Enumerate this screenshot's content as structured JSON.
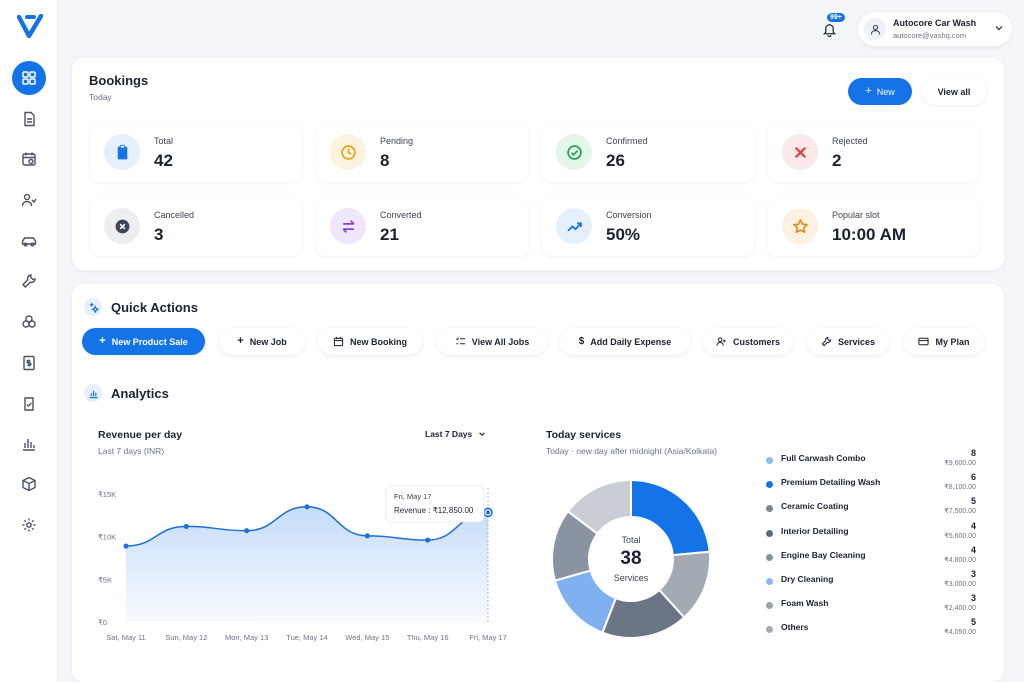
{
  "sidebar": {
    "logo": "V",
    "items": [
      {
        "icon": "grid-icon"
      },
      {
        "icon": "document-icon"
      },
      {
        "icon": "calendar-icon"
      },
      {
        "icon": "users-icon"
      },
      {
        "icon": "car-icon"
      },
      {
        "icon": "wrench-icon"
      },
      {
        "icon": "layers-icon"
      },
      {
        "icon": "invoice-icon"
      },
      {
        "icon": "clipboard-check-icon"
      },
      {
        "icon": "bar-chart-icon"
      },
      {
        "icon": "box-icon"
      },
      {
        "icon": "settings-icon"
      }
    ]
  },
  "header": {
    "notifications_badge": "99+",
    "user": {
      "name": "Autocore Car Wash",
      "email": "autocore@vashq.com"
    }
  },
  "bookings": {
    "title": "Bookings",
    "subtitle": "Today",
    "new_label": "New",
    "view_all_label": "View all",
    "stats": [
      {
        "label": "Total",
        "value": "42"
      },
      {
        "label": "Pending",
        "value": "8"
      },
      {
        "label": "Confirmed",
        "value": "26"
      },
      {
        "label": "Rejected",
        "value": "2"
      },
      {
        "label": "Cancelled",
        "value": "3"
      },
      {
        "label": "Converted",
        "value": "21"
      },
      {
        "label": "Conversion",
        "value": "50%"
      },
      {
        "label": "Popular slot",
        "value": "10:00 AM"
      }
    ]
  },
  "quick_actions": {
    "title": "Quick Actions",
    "buttons": [
      {
        "label": "New Product Sale"
      },
      {
        "label": "New Job"
      },
      {
        "label": "New Booking"
      },
      {
        "label": "View All Jobs"
      },
      {
        "label": "Add Daily Expense"
      },
      {
        "label": "Customers"
      },
      {
        "label": "Services"
      },
      {
        "label": "My Plan"
      }
    ]
  },
  "analytics": {
    "title": "Analytics",
    "revenue": {
      "title": "Revenue per day",
      "subtitle": "Last 7 days (INR)",
      "range": "Last 7 Days",
      "tooltip": {
        "date": "Fri, May 17",
        "label": "Revenue : ₹12,850.00"
      }
    },
    "services": {
      "title": "Today services",
      "subtitle": "Today · new day after midnight (Asia/Kolkata)",
      "total_label": "Total",
      "total_value": "38",
      "total_unit": "Services",
      "items": [
        {
          "name": "Full Carwash Combo",
          "count": "8",
          "amount": "₹9,600.00",
          "color": "#8fb8f2"
        },
        {
          "name": "Premium Detailing Wash",
          "count": "6",
          "amount": "₹8,100.00",
          "color": "#1473e6"
        },
        {
          "name": "Ceramic Coating",
          "count": "5",
          "amount": "₹7,500.00",
          "color": "#7b8595"
        },
        {
          "name": "Interior Detailing",
          "count": "4",
          "amount": "₹5,600.00",
          "color": "#5f6878"
        },
        {
          "name": "Engine Bay Cleaning",
          "count": "4",
          "amount": "₹4,800.00",
          "color": "#8a93a2"
        },
        {
          "name": "Dry Cleaning",
          "count": "3",
          "amount": "₹3,000.00",
          "color": "#8fb8f2"
        },
        {
          "name": "Foam Wash",
          "count": "3",
          "amount": "₹2,400.00",
          "color": "#9aa2ae"
        },
        {
          "name": "Others",
          "count": "5",
          "amount": "₹4,050.00",
          "color": "#a3aab4"
        }
      ]
    }
  },
  "chart_data": [
    {
      "type": "area",
      "title": "Revenue per day",
      "categories": [
        "Sat, May 11",
        "Sun, May 12",
        "Mon, May 13",
        "Tue, May 14",
        "Wed, May 15",
        "Thu, May 16",
        "Fri, May 17"
      ],
      "values": [
        8900,
        11200,
        10700,
        13500,
        10100,
        9600,
        12850
      ],
      "yticks": [
        "₹15K",
        "₹10K",
        "₹5K",
        "₹0"
      ],
      "ylim": [
        0,
        15000
      ],
      "grid": false
    },
    {
      "type": "pie",
      "title": "Today services",
      "labels": [
        "Premium Detailing Wash",
        "Foam Wash",
        "Interior Detailing",
        "Dry Cleaning",
        "Ceramic Coating",
        "Others"
      ],
      "values": [
        8,
        5,
        6,
        5,
        5,
        5
      ],
      "colors": [
        "#1473e6",
        "#a3aab4",
        "#6c7585",
        "#7fb0f0",
        "#8a93a2",
        "#c9ced6"
      ]
    }
  ]
}
